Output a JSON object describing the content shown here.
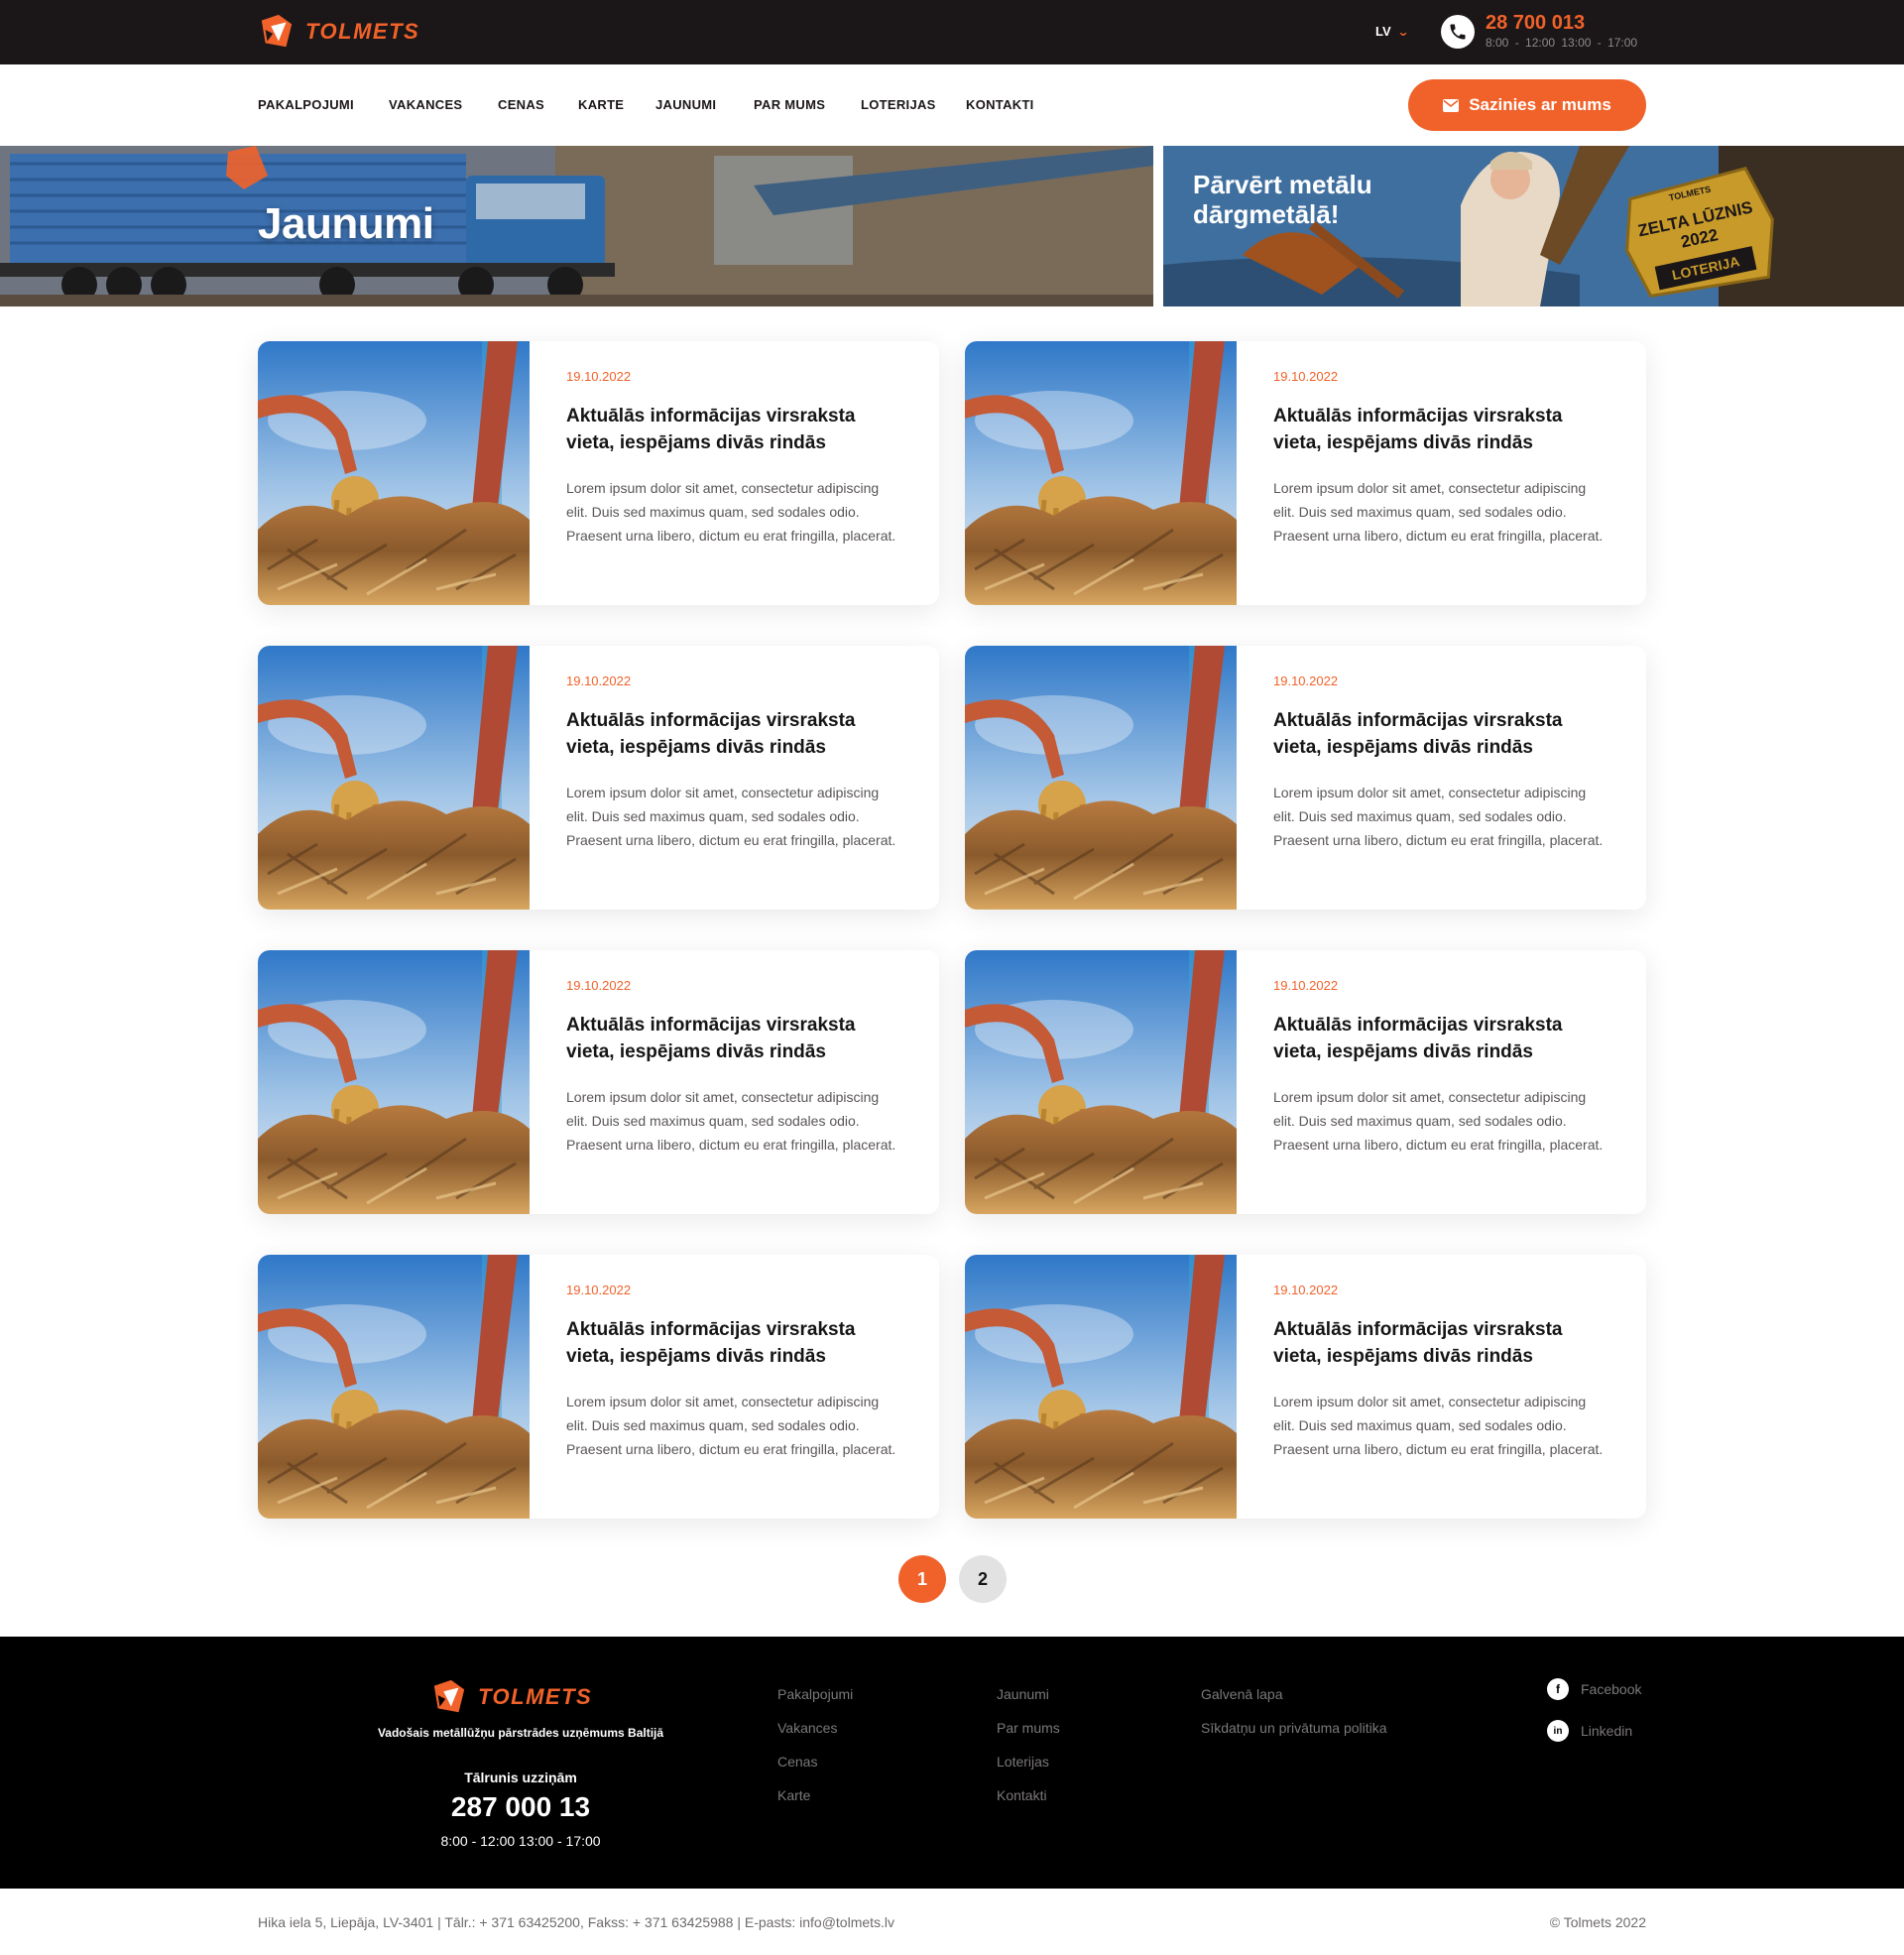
{
  "brand": {
    "name": "TOLMETS",
    "accent": "#f0622a",
    "dark": "#1b1617"
  },
  "topbar": {
    "language": "LV",
    "phone": "28 700 013",
    "hours": "8:00 - 12:00 13:00 - 17:00"
  },
  "nav": {
    "items": [
      "PAKALPOJUMI",
      "VAKANCES",
      "CENAS",
      "KARTE",
      "JAUNUMI",
      "PAR MUMS",
      "LOTERIJAS",
      "KONTAKTI"
    ],
    "contact_button": "Sazinies ar mums"
  },
  "hero": {
    "title": "Jaunumi"
  },
  "promo": {
    "text": "Pārvērt metālu dārgmetālā!",
    "badge_lines": [
      "TOLMETS",
      "ZELTA LŪZNIS 2022",
      "LOTERIJA"
    ]
  },
  "news": [
    {
      "date": "19.10.2022",
      "title": "Aktuālās informācijas virsraksta vieta, iespējams divās rindās",
      "text": "Lorem ipsum dolor sit amet, consectetur adipiscing elit. Duis sed maximus quam, sed sodales odio. Praesent urna libero, dictum eu erat fringilla, placerat."
    },
    {
      "date": "19.10.2022",
      "title": "Aktuālās informācijas virsraksta vieta, iespējams divās rindās",
      "text": "Lorem ipsum dolor sit amet, consectetur adipiscing elit. Duis sed maximus quam, sed sodales odio. Praesent urna libero, dictum eu erat fringilla, placerat."
    },
    {
      "date": "19.10.2022",
      "title": "Aktuālās informācijas virsraksta vieta, iespējams divās rindās",
      "text": "Lorem ipsum dolor sit amet, consectetur adipiscing elit. Duis sed maximus quam, sed sodales odio. Praesent urna libero, dictum eu erat fringilla, placerat."
    },
    {
      "date": "19.10.2022",
      "title": "Aktuālās informācijas virsraksta vieta, iespējams divās rindās",
      "text": "Lorem ipsum dolor sit amet, consectetur adipiscing elit. Duis sed maximus quam, sed sodales odio. Praesent urna libero, dictum eu erat fringilla, placerat."
    },
    {
      "date": "19.10.2022",
      "title": "Aktuālās informācijas virsraksta vieta, iespējams divās rindās",
      "text": "Lorem ipsum dolor sit amet, consectetur adipiscing elit. Duis sed maximus quam, sed sodales odio. Praesent urna libero, dictum eu erat fringilla, placerat."
    },
    {
      "date": "19.10.2022",
      "title": "Aktuālās informācijas virsraksta vieta, iespējams divās rindās",
      "text": "Lorem ipsum dolor sit amet, consectetur adipiscing elit. Duis sed maximus quam, sed sodales odio. Praesent urna libero, dictum eu erat fringilla, placerat."
    },
    {
      "date": "19.10.2022",
      "title": "Aktuālās informācijas virsraksta vieta, iespējams divās rindās",
      "text": "Lorem ipsum dolor sit amet, consectetur adipiscing elit. Duis sed maximus quam, sed sodales odio. Praesent urna libero, dictum eu erat fringilla, placerat."
    },
    {
      "date": "19.10.2022",
      "title": "Aktuālās informācijas virsraksta vieta, iespējams divās rindās",
      "text": "Lorem ipsum dolor sit amet, consectetur adipiscing elit. Duis sed maximus quam, sed sodales odio. Praesent urna libero, dictum eu erat fringilla, placerat."
    }
  ],
  "pagination": {
    "pages": [
      "1",
      "2"
    ],
    "current": "1"
  },
  "footer": {
    "tagline": "Vadošais metāllūžņu pārstrādes uzņēmums Baltijā",
    "phone_label": "Tālrunis uzziņām",
    "phone": "287 000 13",
    "hours": "8:00 - 12:00 13:00 - 17:00",
    "col1": [
      "Pakalpojumi",
      "Vakances",
      "Cenas",
      "Karte"
    ],
    "col2": [
      "Jaunumi",
      "Par mums",
      "Loterijas",
      "Kontakti"
    ],
    "col3": [
      "Galvenā lapa",
      "Sīkdatņu un privātuma politika"
    ],
    "social": [
      {
        "label": "Facebook",
        "icon": "facebook-icon"
      },
      {
        "label": "Linkedin",
        "icon": "linkedin-icon"
      }
    ]
  },
  "bottom": {
    "address": "Hika iela 5, Liepāja, LV-3401 | Tālr.: + 371 63425200, Fakss: + 371 63425988 | E-pasts: info@tolmets.lv",
    "copyright": "© Tolmets 2022"
  }
}
